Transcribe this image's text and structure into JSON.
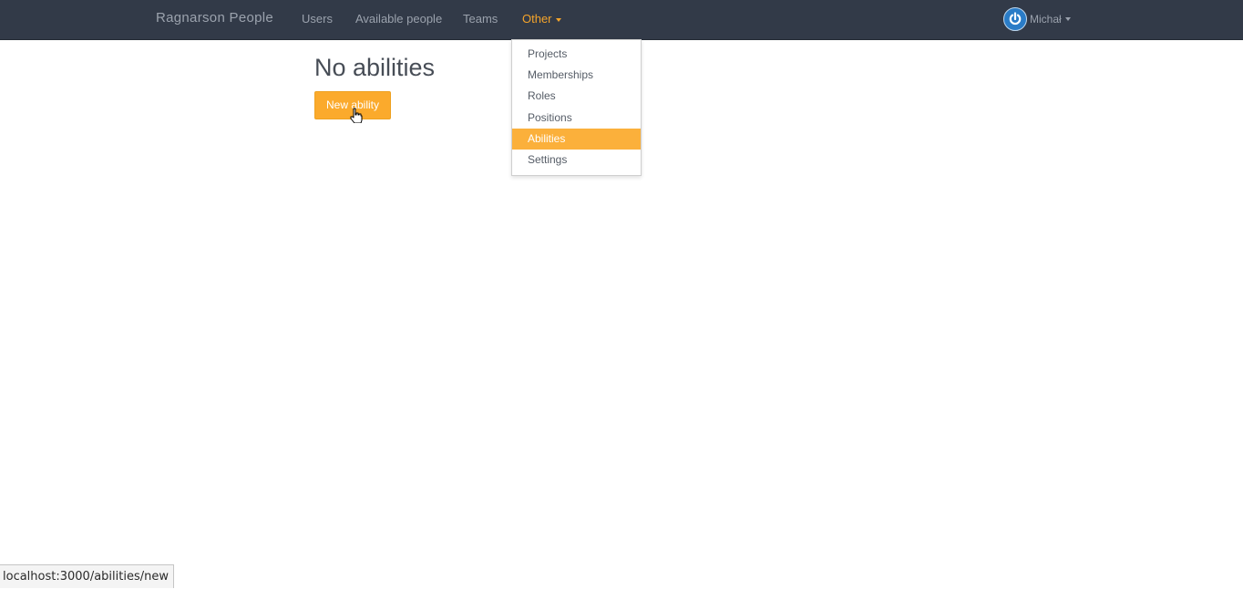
{
  "navbar": {
    "brand": "Ragnarson People",
    "links": [
      "Users",
      "Available people",
      "Teams"
    ],
    "other_label": "Other",
    "user_name": "Michał",
    "avatar_icon": "power-icon",
    "accent_color": "#f5a42a"
  },
  "dropdown": {
    "items": [
      "Projects",
      "Memberships",
      "Roles",
      "Positions",
      "Abilities",
      "Settings"
    ],
    "selected": "Abilities"
  },
  "main": {
    "title": "No abilities",
    "new_button_label": "New ability"
  },
  "status_bar": {
    "url": "localhost:3000/abilities/new"
  }
}
